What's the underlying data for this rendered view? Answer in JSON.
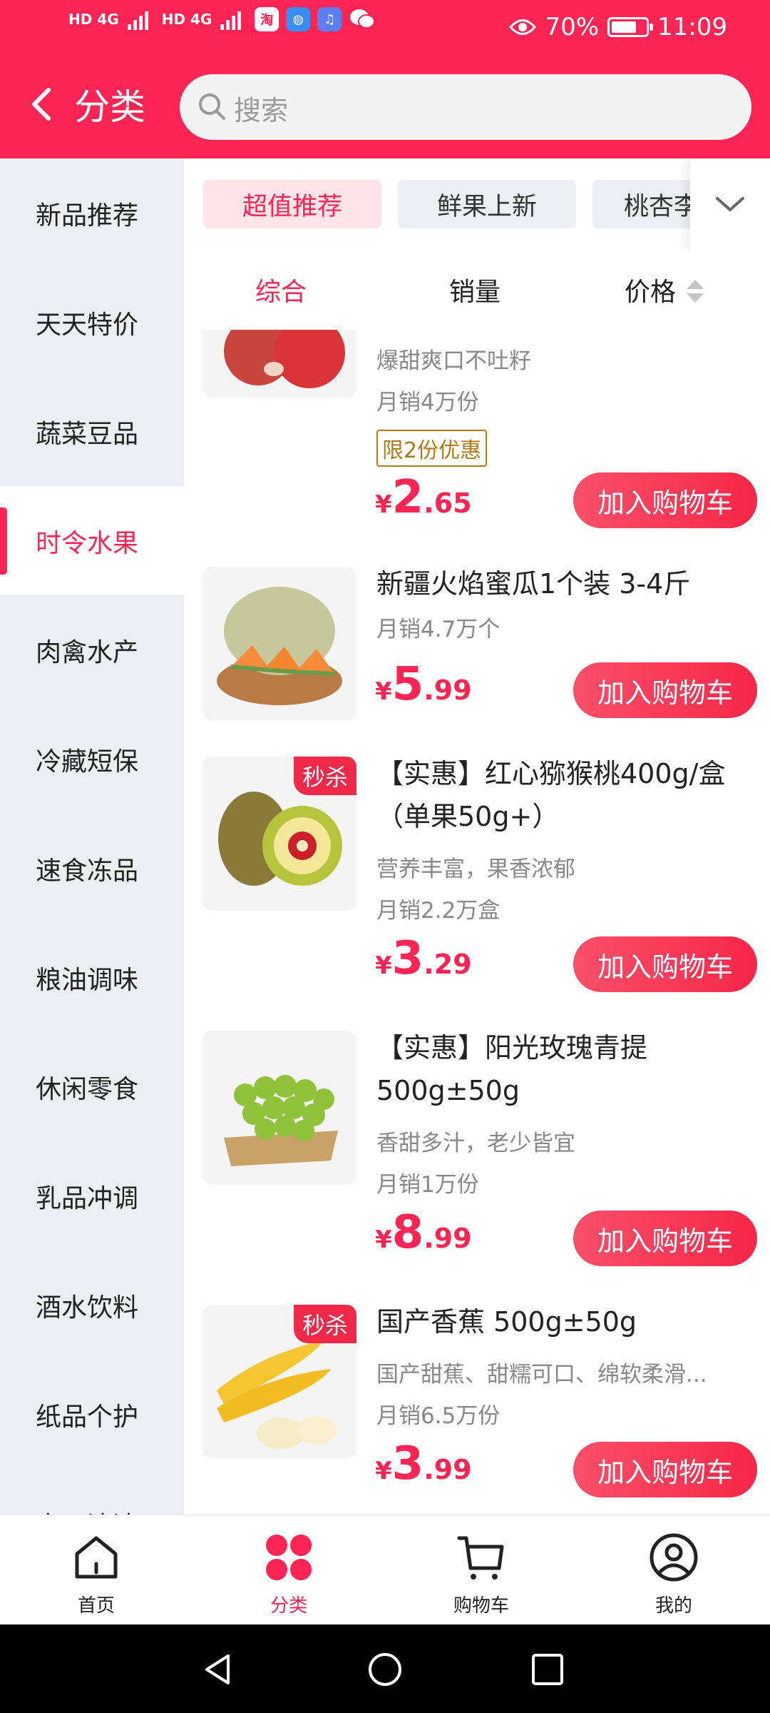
{
  "status_bar": {
    "signal_left": "HD 4G",
    "signal_right": "HD 4G",
    "app_label": "淘",
    "battery": "70%",
    "time": "11:09"
  },
  "header": {
    "title": "分类",
    "search_placeholder": "搜索"
  },
  "sidebar": {
    "items": [
      {
        "label": "新品推荐"
      },
      {
        "label": "天天特价"
      },
      {
        "label": "蔬菜豆品"
      },
      {
        "label": "时令水果"
      },
      {
        "label": "肉禽水产"
      },
      {
        "label": "冷藏短保"
      },
      {
        "label": "速食冻品"
      },
      {
        "label": "粮油调味"
      },
      {
        "label": "休闲零食"
      },
      {
        "label": "乳品冲调"
      },
      {
        "label": "酒水饮料"
      },
      {
        "label": "纸品个护"
      },
      {
        "label": "家用清洁"
      }
    ]
  },
  "tags": [
    "超值推荐",
    "鲜果上新",
    "桃杏李"
  ],
  "sort": {
    "comprehensive": "综合",
    "sales": "销量",
    "price": "价格"
  },
  "products": [
    {
      "title": "",
      "subtitle": "爆甜爽口不吐籽",
      "sales": "月销4万份",
      "limit": "限2份优惠",
      "currency": "¥",
      "price_int": "2",
      "price_dec": ".65",
      "cart": "加入购物车",
      "image": "pomegranate"
    },
    {
      "title": "新疆火焰蜜瓜1个装 3-4斤",
      "sales": "月销4.7万个",
      "currency": "¥",
      "price_int": "5",
      "price_dec": ".99",
      "cart": "加入购物车",
      "image": "melon"
    },
    {
      "title": "【实惠】红心猕猴桃400g/盒（单果50g+）",
      "subtitle": "营养丰富，果香浓郁",
      "sales": "月销2.2万盒",
      "badge": "秒杀",
      "currency": "¥",
      "price_int": "3",
      "price_dec": ".29",
      "cart": "加入购物车",
      "image": "kiwi"
    },
    {
      "title": "【实惠】阳光玫瑰青提 500g±50g",
      "subtitle": "香甜多汁，老少皆宜",
      "sales": "月销1万份",
      "currency": "¥",
      "price_int": "8",
      "price_dec": ".99",
      "cart": "加入购物车",
      "image": "grapes"
    },
    {
      "title": "国产香蕉 500g±50g",
      "subtitle": "国产甜蕉、甜糯可口、绵软柔滑...",
      "sales": "月销6.5万份",
      "badge": "秒杀",
      "currency": "¥",
      "price_int": "3",
      "price_dec": ".99",
      "cart": "加入购物车",
      "image": "banana"
    }
  ],
  "bottom_nav": {
    "home": "首页",
    "category": "分类",
    "cart": "购物车",
    "mine": "我的"
  },
  "colors": {
    "brand": "#fd2553",
    "sidebar_bg": "#eceef2"
  }
}
